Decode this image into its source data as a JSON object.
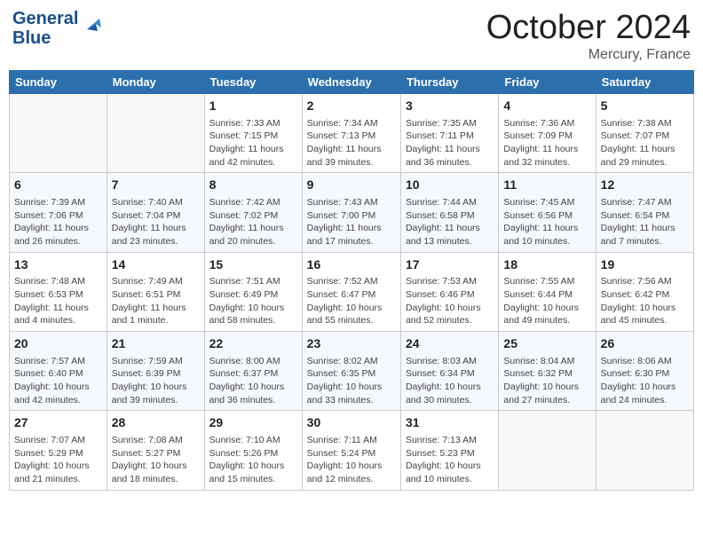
{
  "header": {
    "logo_line1": "General",
    "logo_line2": "Blue",
    "month": "October 2024",
    "location": "Mercury, France"
  },
  "days_of_week": [
    "Sunday",
    "Monday",
    "Tuesday",
    "Wednesday",
    "Thursday",
    "Friday",
    "Saturday"
  ],
  "weeks": [
    [
      {
        "day": "",
        "sunrise": "",
        "sunset": "",
        "daylight": ""
      },
      {
        "day": "",
        "sunrise": "",
        "sunset": "",
        "daylight": ""
      },
      {
        "day": "1",
        "sunrise": "Sunrise: 7:33 AM",
        "sunset": "Sunset: 7:15 PM",
        "daylight": "Daylight: 11 hours and 42 minutes."
      },
      {
        "day": "2",
        "sunrise": "Sunrise: 7:34 AM",
        "sunset": "Sunset: 7:13 PM",
        "daylight": "Daylight: 11 hours and 39 minutes."
      },
      {
        "day": "3",
        "sunrise": "Sunrise: 7:35 AM",
        "sunset": "Sunset: 7:11 PM",
        "daylight": "Daylight: 11 hours and 36 minutes."
      },
      {
        "day": "4",
        "sunrise": "Sunrise: 7:36 AM",
        "sunset": "Sunset: 7:09 PM",
        "daylight": "Daylight: 11 hours and 32 minutes."
      },
      {
        "day": "5",
        "sunrise": "Sunrise: 7:38 AM",
        "sunset": "Sunset: 7:07 PM",
        "daylight": "Daylight: 11 hours and 29 minutes."
      }
    ],
    [
      {
        "day": "6",
        "sunrise": "Sunrise: 7:39 AM",
        "sunset": "Sunset: 7:06 PM",
        "daylight": "Daylight: 11 hours and 26 minutes."
      },
      {
        "day": "7",
        "sunrise": "Sunrise: 7:40 AM",
        "sunset": "Sunset: 7:04 PM",
        "daylight": "Daylight: 11 hours and 23 minutes."
      },
      {
        "day": "8",
        "sunrise": "Sunrise: 7:42 AM",
        "sunset": "Sunset: 7:02 PM",
        "daylight": "Daylight: 11 hours and 20 minutes."
      },
      {
        "day": "9",
        "sunrise": "Sunrise: 7:43 AM",
        "sunset": "Sunset: 7:00 PM",
        "daylight": "Daylight: 11 hours and 17 minutes."
      },
      {
        "day": "10",
        "sunrise": "Sunrise: 7:44 AM",
        "sunset": "Sunset: 6:58 PM",
        "daylight": "Daylight: 11 hours and 13 minutes."
      },
      {
        "day": "11",
        "sunrise": "Sunrise: 7:45 AM",
        "sunset": "Sunset: 6:56 PM",
        "daylight": "Daylight: 11 hours and 10 minutes."
      },
      {
        "day": "12",
        "sunrise": "Sunrise: 7:47 AM",
        "sunset": "Sunset: 6:54 PM",
        "daylight": "Daylight: 11 hours and 7 minutes."
      }
    ],
    [
      {
        "day": "13",
        "sunrise": "Sunrise: 7:48 AM",
        "sunset": "Sunset: 6:53 PM",
        "daylight": "Daylight: 11 hours and 4 minutes."
      },
      {
        "day": "14",
        "sunrise": "Sunrise: 7:49 AM",
        "sunset": "Sunset: 6:51 PM",
        "daylight": "Daylight: 11 hours and 1 minute."
      },
      {
        "day": "15",
        "sunrise": "Sunrise: 7:51 AM",
        "sunset": "Sunset: 6:49 PM",
        "daylight": "Daylight: 10 hours and 58 minutes."
      },
      {
        "day": "16",
        "sunrise": "Sunrise: 7:52 AM",
        "sunset": "Sunset: 6:47 PM",
        "daylight": "Daylight: 10 hours and 55 minutes."
      },
      {
        "day": "17",
        "sunrise": "Sunrise: 7:53 AM",
        "sunset": "Sunset: 6:46 PM",
        "daylight": "Daylight: 10 hours and 52 minutes."
      },
      {
        "day": "18",
        "sunrise": "Sunrise: 7:55 AM",
        "sunset": "Sunset: 6:44 PM",
        "daylight": "Daylight: 10 hours and 49 minutes."
      },
      {
        "day": "19",
        "sunrise": "Sunrise: 7:56 AM",
        "sunset": "Sunset: 6:42 PM",
        "daylight": "Daylight: 10 hours and 45 minutes."
      }
    ],
    [
      {
        "day": "20",
        "sunrise": "Sunrise: 7:57 AM",
        "sunset": "Sunset: 6:40 PM",
        "daylight": "Daylight: 10 hours and 42 minutes."
      },
      {
        "day": "21",
        "sunrise": "Sunrise: 7:59 AM",
        "sunset": "Sunset: 6:39 PM",
        "daylight": "Daylight: 10 hours and 39 minutes."
      },
      {
        "day": "22",
        "sunrise": "Sunrise: 8:00 AM",
        "sunset": "Sunset: 6:37 PM",
        "daylight": "Daylight: 10 hours and 36 minutes."
      },
      {
        "day": "23",
        "sunrise": "Sunrise: 8:02 AM",
        "sunset": "Sunset: 6:35 PM",
        "daylight": "Daylight: 10 hours and 33 minutes."
      },
      {
        "day": "24",
        "sunrise": "Sunrise: 8:03 AM",
        "sunset": "Sunset: 6:34 PM",
        "daylight": "Daylight: 10 hours and 30 minutes."
      },
      {
        "day": "25",
        "sunrise": "Sunrise: 8:04 AM",
        "sunset": "Sunset: 6:32 PM",
        "daylight": "Daylight: 10 hours and 27 minutes."
      },
      {
        "day": "26",
        "sunrise": "Sunrise: 8:06 AM",
        "sunset": "Sunset: 6:30 PM",
        "daylight": "Daylight: 10 hours and 24 minutes."
      }
    ],
    [
      {
        "day": "27",
        "sunrise": "Sunrise: 7:07 AM",
        "sunset": "Sunset: 5:29 PM",
        "daylight": "Daylight: 10 hours and 21 minutes."
      },
      {
        "day": "28",
        "sunrise": "Sunrise: 7:08 AM",
        "sunset": "Sunset: 5:27 PM",
        "daylight": "Daylight: 10 hours and 18 minutes."
      },
      {
        "day": "29",
        "sunrise": "Sunrise: 7:10 AM",
        "sunset": "Sunset: 5:26 PM",
        "daylight": "Daylight: 10 hours and 15 minutes."
      },
      {
        "day": "30",
        "sunrise": "Sunrise: 7:11 AM",
        "sunset": "Sunset: 5:24 PM",
        "daylight": "Daylight: 10 hours and 12 minutes."
      },
      {
        "day": "31",
        "sunrise": "Sunrise: 7:13 AM",
        "sunset": "Sunset: 5:23 PM",
        "daylight": "Daylight: 10 hours and 10 minutes."
      },
      {
        "day": "",
        "sunrise": "",
        "sunset": "",
        "daylight": ""
      },
      {
        "day": "",
        "sunrise": "",
        "sunset": "",
        "daylight": ""
      }
    ]
  ]
}
